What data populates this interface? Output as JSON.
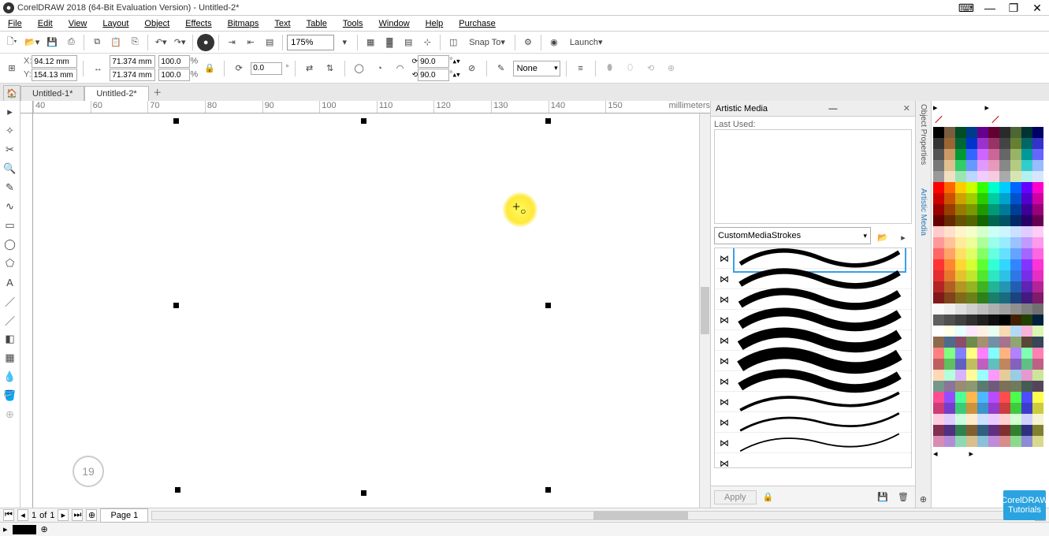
{
  "app": {
    "title": "CorelDRAW 2018 (64-Bit Evaluation Version) - Untitled-2*"
  },
  "menu": [
    "File",
    "Edit",
    "View",
    "Layout",
    "Object",
    "Effects",
    "Bitmaps",
    "Text",
    "Table",
    "Tools",
    "Window",
    "Help",
    "Purchase"
  ],
  "toolbar1": {
    "zoom": "175%",
    "snap": "Snap To",
    "launch": "Launch"
  },
  "propbar": {
    "x_label": "X:",
    "y_label": "Y:",
    "x": "94.12 mm",
    "y": "154.13 mm",
    "w": "71.374 mm",
    "h": "71.374 mm",
    "sx": "100.0",
    "sy": "100.0",
    "pct": "%",
    "angle": "0.0",
    "rot1": "90.0",
    "rot2": "90.0",
    "deg": "°",
    "none": "None"
  },
  "tabs": {
    "tab1": "Untitled-1*",
    "tab2": "Untitled-2*"
  },
  "ruler": {
    "unit": "millimeters",
    "ticks": [
      "40",
      "60",
      "70",
      "80",
      "90",
      "100",
      "110",
      "120",
      "130",
      "140",
      "150"
    ]
  },
  "docker": {
    "title": "Artistic Media",
    "last_used": "Last Used:",
    "stroke_category": "CustomMediaStrokes",
    "apply": "Apply"
  },
  "sidetabs": {
    "t1": "Object Properties",
    "t2": "Artistic Media"
  },
  "pagenav": {
    "page_num": "1",
    "of": "of",
    "total": "1",
    "page_tab": "Page 1"
  },
  "badge": {
    "l1": "CorelDRAW",
    "l2": "Tutorials"
  },
  "hint_circle": "19",
  "palette_colors": [
    "#000000",
    "#7a5c3f",
    "#004d26",
    "#003a8c",
    "#66008c",
    "#630031",
    "#2a2a2a",
    "#4d6633",
    "#003333",
    "#000066",
    "#333333",
    "#996633",
    "#006633",
    "#0033cc",
    "#9933cc",
    "#993366",
    "#444444",
    "#668033",
    "#006666",
    "#3333cc",
    "#555555",
    "#cc9966",
    "#009933",
    "#3366ff",
    "#cc66ff",
    "#cc6699",
    "#666666",
    "#99b366",
    "#009999",
    "#6666ff",
    "#777777",
    "#e0c090",
    "#33cc66",
    "#6699ff",
    "#e099ff",
    "#e699bb",
    "#888888",
    "#b3cc80",
    "#33cccc",
    "#99bbff",
    "#999999",
    "#f0e0c0",
    "#99e6b3",
    "#bbd6ff",
    "#f0ccff",
    "#f5ccdd",
    "#aaaaaa",
    "#d6e6b3",
    "#b3f0f0",
    "#d6e6ff",
    "#ff0000",
    "#ff6600",
    "#ffcc00",
    "#ccff00",
    "#33ff00",
    "#00ffcc",
    "#00ccff",
    "#0066ff",
    "#6600ff",
    "#ff00cc",
    "#cc0000",
    "#cc5200",
    "#cca300",
    "#a3cc00",
    "#29cc00",
    "#00cca3",
    "#00a3cc",
    "#0052cc",
    "#5200cc",
    "#cc00a3",
    "#990000",
    "#993d00",
    "#997a00",
    "#7a9900",
    "#1f9900",
    "#00997a",
    "#007a99",
    "#003d99",
    "#3d0099",
    "#99007a",
    "#660000",
    "#662900",
    "#665200",
    "#526600",
    "#146600",
    "#006652",
    "#005266",
    "#002966",
    "#290066",
    "#660052",
    "#ffcccc",
    "#ffe0cc",
    "#fff5cc",
    "#f5ffcc",
    "#d6ffcc",
    "#ccfff5",
    "#ccf5ff",
    "#cce0ff",
    "#e0ccff",
    "#ffccf5",
    "#ff9999",
    "#ffc299",
    "#ffeb99",
    "#ebff99",
    "#adff99",
    "#99ffeb",
    "#99ebff",
    "#99c2ff",
    "#c299ff",
    "#ff99eb",
    "#ff6666",
    "#ffa366",
    "#ffe066",
    "#e0ff66",
    "#85ff66",
    "#66ffe0",
    "#66e0ff",
    "#66a3ff",
    "#a366ff",
    "#ff66e0",
    "#ff3333",
    "#ff8533",
    "#ffd633",
    "#d6ff33",
    "#5cff33",
    "#33ffd6",
    "#33d6ff",
    "#3385ff",
    "#8533ff",
    "#ff33d6",
    "#e62e2e",
    "#e6782e",
    "#e6c12e",
    "#c1e62e",
    "#52e62e",
    "#2ee6c1",
    "#2ec1e6",
    "#2e78e6",
    "#782ee6",
    "#e62ec1",
    "#b32424",
    "#b35e24",
    "#b39624",
    "#96b324",
    "#40b324",
    "#24b396",
    "#2496b3",
    "#245eb3",
    "#5e24b3",
    "#b32496",
    "#801a1a",
    "#80431a",
    "#806b1a",
    "#6b801a",
    "#2e801a",
    "#1a806b",
    "#1a6b80",
    "#1a4380",
    "#431a80",
    "#801a6b",
    "#fafafa",
    "#f0f0f0",
    "#e0e0e0",
    "#d0d0d0",
    "#c0c0c0",
    "#b0b0b0",
    "#a0a0a0",
    "#909090",
    "#808080",
    "#707070",
    "#606060",
    "#505050",
    "#404040",
    "#303030",
    "#202020",
    "#101010",
    "#000000",
    "#402000",
    "#204000",
    "#002040",
    "#ffffff",
    "#ffffe6",
    "#e6ffff",
    "#ffe6ff",
    "#fff0e6",
    "#e6fff0",
    "#f7d9b3",
    "#b3d9f7",
    "#f7b3d9",
    "#d9f7b3",
    "#8c6b4d",
    "#4d6b8c",
    "#8c4d6b",
    "#6b8c4d",
    "#a68f73",
    "#738fa6",
    "#a6738f",
    "#8fa673",
    "#594735",
    "#354759",
    "#ff8080",
    "#80ff80",
    "#8080ff",
    "#ffff80",
    "#ff80ff",
    "#80ffff",
    "#ffb380",
    "#b380ff",
    "#80ffb3",
    "#ff80b3",
    "#bf6060",
    "#60bf60",
    "#6060bf",
    "#bfbf60",
    "#bf60bf",
    "#60bfbf",
    "#bf8660",
    "#8660bf",
    "#60bf86",
    "#bf6086",
    "#ffd9b3",
    "#b3ffd9",
    "#d9b3ff",
    "#fffb99",
    "#99fffb",
    "#fb99ff",
    "#e6cc99",
    "#99cce6",
    "#e699cc",
    "#cce699",
    "#73998c",
    "#8c7399",
    "#998c73",
    "#8c9973",
    "#5c7a70",
    "#705c7a",
    "#7a705c",
    "#707a5c",
    "#455c54",
    "#54455c",
    "#ff4d94",
    "#944dff",
    "#4dff94",
    "#ffb84d",
    "#4db8ff",
    "#b84dff",
    "#ff4d4d",
    "#4dff4d",
    "#4d4dff",
    "#ffff4d",
    "#cc3d76",
    "#763dcc",
    "#3dcc76",
    "#cc933d",
    "#3d93cc",
    "#933dcc",
    "#cc3d3d",
    "#3dcc3d",
    "#3d3dcc",
    "#cccc3d",
    "#ffcce0",
    "#e0ccff",
    "#ccffe0",
    "#ffeccc",
    "#cce0ff",
    "#ecccff",
    "#ffd1d1",
    "#d1ffd1",
    "#d1d1ff",
    "#f5f5d1",
    "#803050",
    "#503080",
    "#308050",
    "#806030",
    "#306080",
    "#603080",
    "#803030",
    "#308030",
    "#303080",
    "#808030",
    "#d98cb3",
    "#b38cd9",
    "#8cd9b3",
    "#d9bf8c",
    "#8cbfd9",
    "#bf8cd9",
    "#d98c8c",
    "#8cd98c",
    "#8c8cd9",
    "#d9d98c"
  ]
}
